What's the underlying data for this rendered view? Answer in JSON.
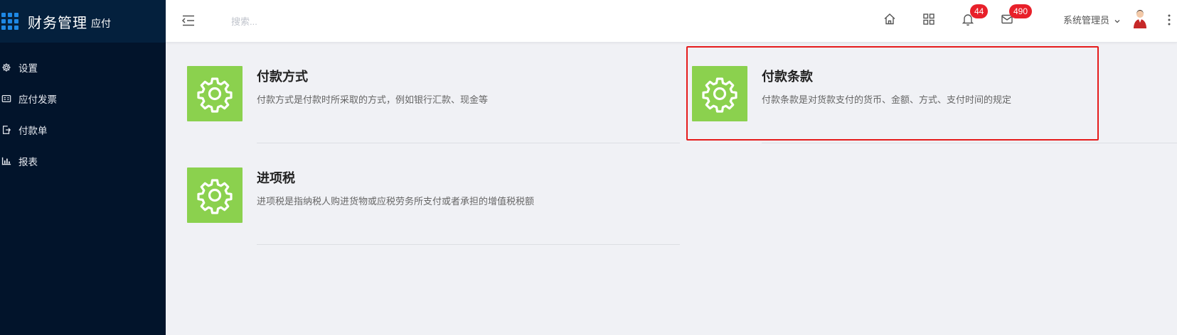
{
  "app": {
    "title": "财务管理",
    "subtitle": "应付"
  },
  "sidebar": {
    "items": [
      {
        "label": "设置",
        "icon": "gear-icon"
      },
      {
        "label": "应付发票",
        "icon": "invoice-icon"
      },
      {
        "label": "付款单",
        "icon": "payment-doc-icon"
      },
      {
        "label": "报表",
        "icon": "bar-chart-icon"
      }
    ]
  },
  "header": {
    "search_placeholder": "搜索...",
    "notifications_count": "44",
    "messages_count": "490",
    "user_name": "系统管理员"
  },
  "cards": [
    {
      "title": "付款方式",
      "description": "付款方式是付款时所采取的方式，例如银行汇款、现金等"
    },
    {
      "title": "付款条款",
      "description": "付款条款是对货款支付的货币、金额、方式、支付时间的规定"
    },
    {
      "title": "进项税",
      "description": "进项税是指纳税人购进货物或应税劳务所支付或者承担的增值税税额"
    }
  ],
  "colors": {
    "sidebar": "#02142b",
    "tile": "#8bd14e",
    "badge": "#e8202a",
    "highlight": "#e51b1b"
  }
}
